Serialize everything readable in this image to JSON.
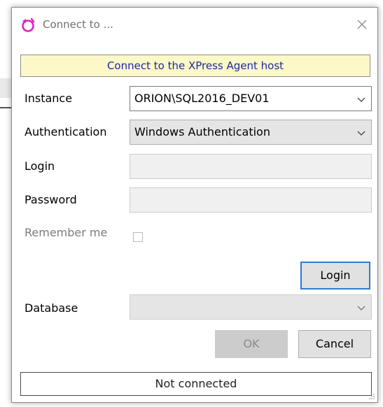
{
  "window": {
    "title": "Connect to ...",
    "accent_color": "#e020c8"
  },
  "banner": {
    "text": "Connect to the XPress Agent host",
    "bg_color": "#fcf8c8",
    "text_color": "#1a2ba0"
  },
  "form": {
    "instance": {
      "label": "Instance",
      "value": "ORION\\SQL2016_DEV01"
    },
    "authentication": {
      "label": "Authentication",
      "value": "Windows Authentication"
    },
    "login": {
      "label": "Login",
      "value": ""
    },
    "password": {
      "label": "Password",
      "value": ""
    },
    "remember": {
      "label": "Remember me",
      "checked": false
    },
    "database": {
      "label": "Database",
      "value": ""
    }
  },
  "buttons": {
    "login": "Login",
    "ok": "OK",
    "cancel": "Cancel"
  },
  "status": {
    "text": "Not connected"
  }
}
